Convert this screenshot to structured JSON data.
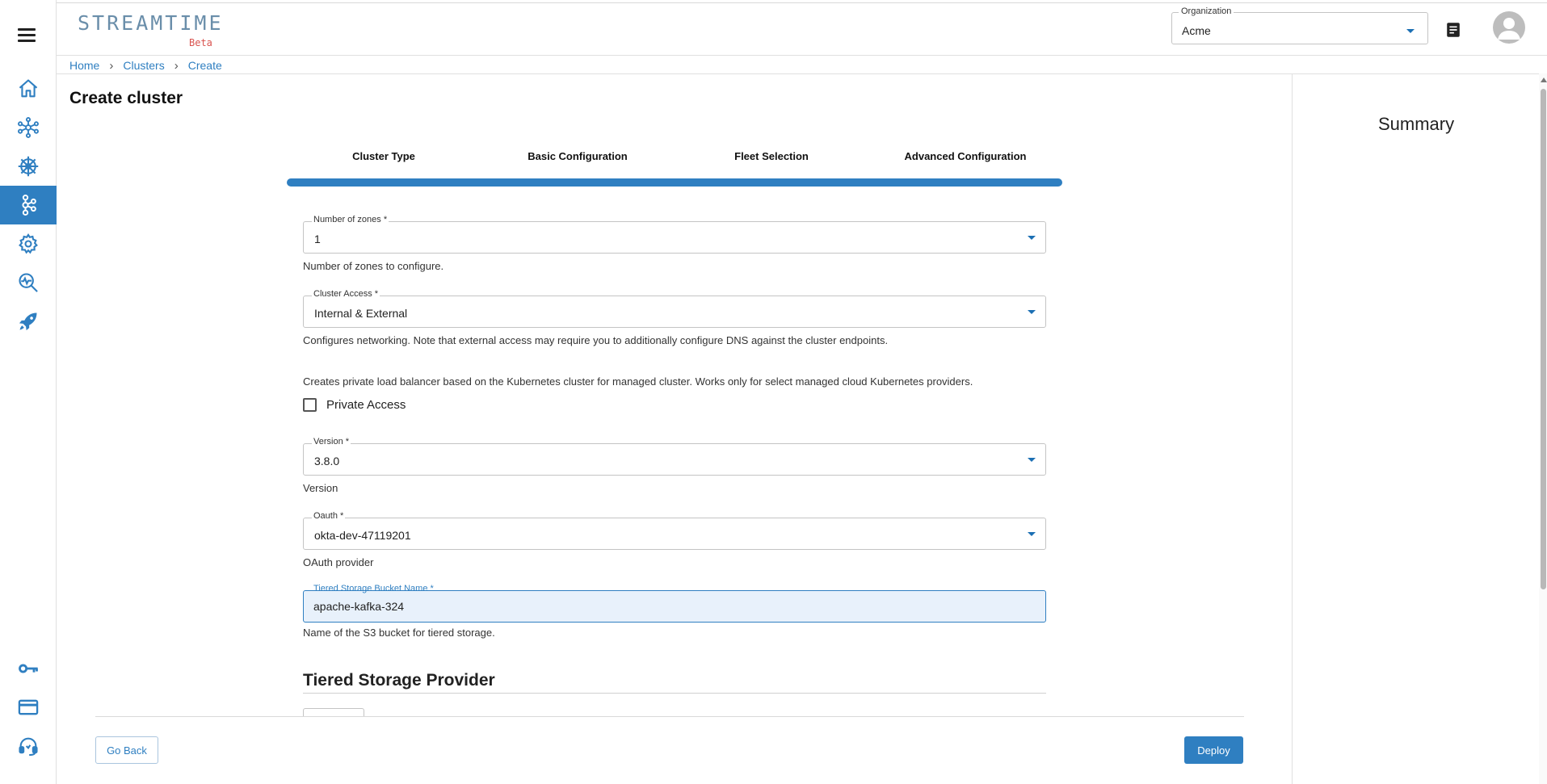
{
  "app": {
    "logo_text": "STREAMTIME",
    "logo_tag": "Beta"
  },
  "header": {
    "org_label": "Organization",
    "org_value": "Acme"
  },
  "rail": {
    "items": [
      "home-icon",
      "cluster-network-icon",
      "helm-wheel-icon",
      "kafka-icon",
      "settings-gear-icon",
      "monitor-search-icon",
      "rocket-icon",
      "key-icon",
      "credit-card-icon",
      "support-headset-icon"
    ],
    "active": "kafka-icon"
  },
  "breadcrumb": {
    "items": [
      "Home",
      "Clusters",
      "Create"
    ]
  },
  "page": {
    "title": "Create cluster"
  },
  "summary": {
    "title": "Summary"
  },
  "stepper": {
    "steps": [
      "Cluster Type",
      "Basic Configuration",
      "Fleet Selection",
      "Advanced Configuration"
    ],
    "progress_percent": 100
  },
  "form": {
    "zones": {
      "label": "Number of zones *",
      "value": "1",
      "helper": "Number of zones to configure."
    },
    "access": {
      "label": "Cluster Access *",
      "value": "Internal & External",
      "helper": "Configures networking. Note that external access may require you to additionally configure DNS against the cluster endpoints."
    },
    "private_access": {
      "description": "Creates private load balancer based on the Kubernetes cluster for managed cluster. Works only for select managed cloud Kubernetes providers.",
      "label": "Private Access",
      "checked": false
    },
    "version": {
      "label": "Version *",
      "value": "3.8.0",
      "helper": "Version"
    },
    "oauth": {
      "label": "Oauth *",
      "value": "okta-dev-47119201",
      "helper": "OAuth provider"
    },
    "bucket": {
      "label": "Tiered Storage Bucket Name *",
      "value": "apache-kafka-324",
      "helper": "Name of the S3 bucket for tiered storage."
    },
    "provider_section_title": "Tiered Storage Provider"
  },
  "actions": {
    "back_label": "Go Back",
    "deploy_label": "Deploy"
  },
  "colors": {
    "accent": "#2f7fc1",
    "logo": "#6a8eaa",
    "beta": "#d9534f"
  }
}
